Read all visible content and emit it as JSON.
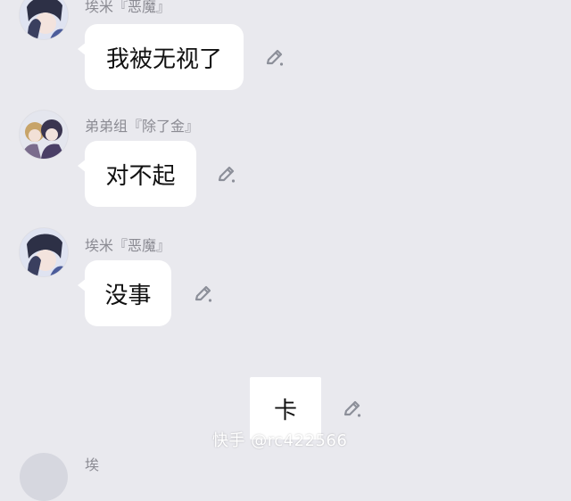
{
  "messages": [
    {
      "sender": "埃米『恶魔』",
      "text": "我被无视了"
    },
    {
      "sender": "弟弟组『除了金』",
      "text": "对不起"
    },
    {
      "sender": "埃米『恶魔』",
      "text": "没事"
    },
    {
      "sender": "",
      "text": "卡"
    }
  ],
  "bottom_partial_sender": "埃 ",
  "watermark": "快手 @rc422566",
  "icons": {
    "edit": "pen-icon",
    "avatar": "avatar"
  },
  "colors": {
    "background": "#e9e9ee",
    "bubble": "#ffffff",
    "name": "#8b8b93",
    "pen": "#8c8f99"
  }
}
